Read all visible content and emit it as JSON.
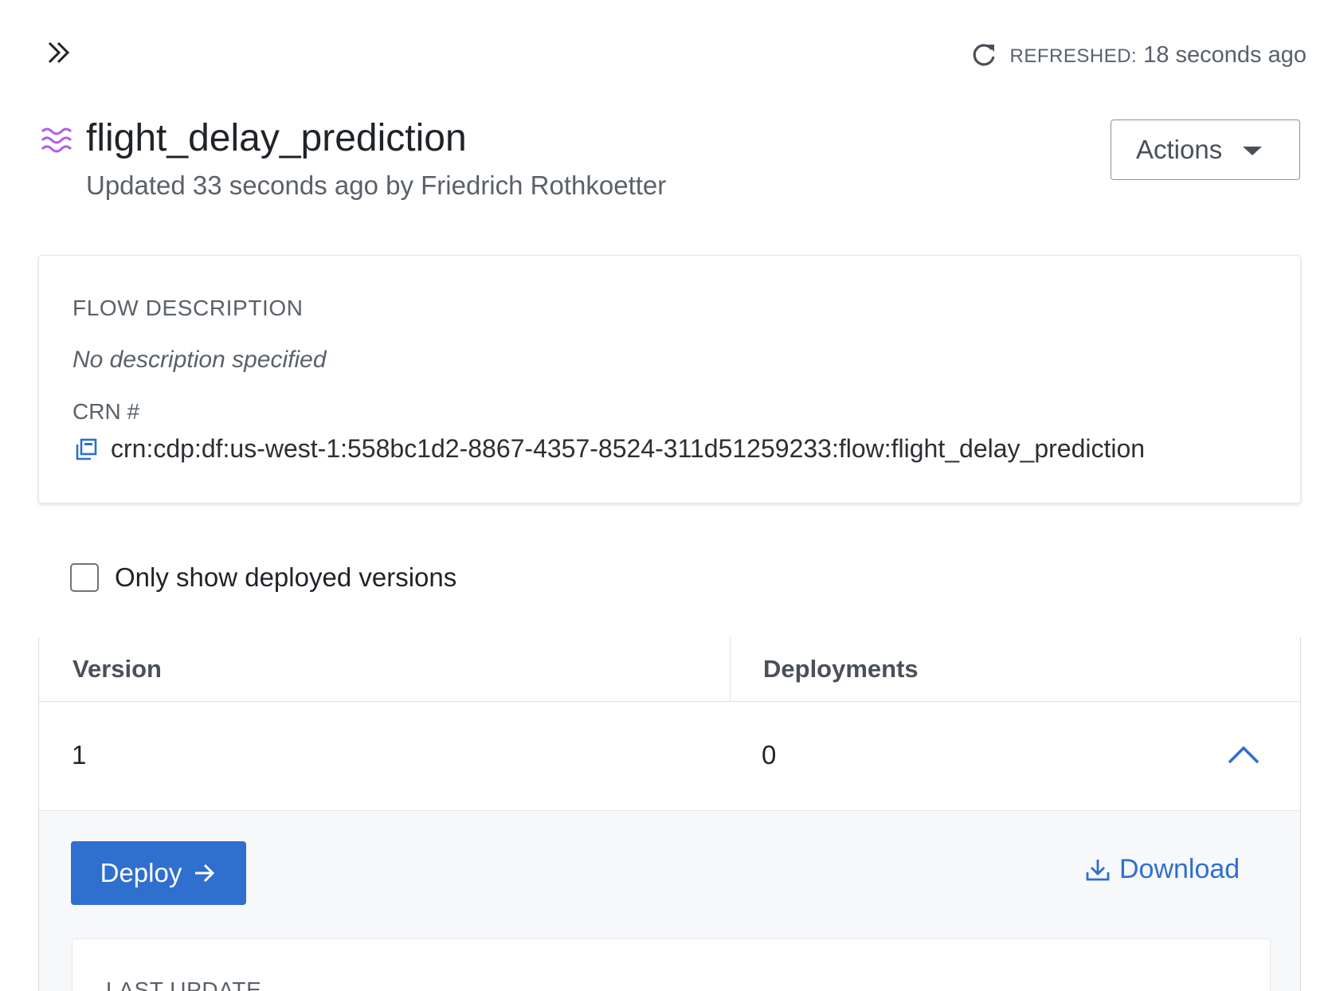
{
  "header": {
    "expand_icon": "double-chevron-right-icon",
    "refresh_icon": "refresh-icon",
    "refreshed_label": "REFRESHED:",
    "refreshed_value": "18 seconds ago"
  },
  "flow": {
    "icon": "flow-waves-icon",
    "title": "flight_delay_prediction",
    "subtitle": "Updated 33 seconds ago by Friedrich Rothkoetter",
    "actions_label": "Actions"
  },
  "description_card": {
    "heading": "FLOW DESCRIPTION",
    "description": "No description specified",
    "crn_heading": "CRN #",
    "crn_value": "crn:cdp:df:us-west-1:558bc1d2-8867-4357-8524-311d51259233:flow:flight_delay_prediction",
    "copy_icon": "copy-icon"
  },
  "filter": {
    "checkbox_label": "Only show deployed versions",
    "checked": false
  },
  "versions_table": {
    "columns": [
      "Version",
      "Deployments"
    ],
    "rows": [
      {
        "version": "1",
        "deployments": "0",
        "expanded": true
      }
    ]
  },
  "expanded_row": {
    "deploy_label": "Deploy",
    "download_label": "Download",
    "last_update_heading": "LAST UPDATE"
  },
  "colors": {
    "primary": "#2f6fcd",
    "flow_icon": "#b45ce8",
    "text_dark": "#1f2327",
    "text_muted": "#5a6169"
  }
}
